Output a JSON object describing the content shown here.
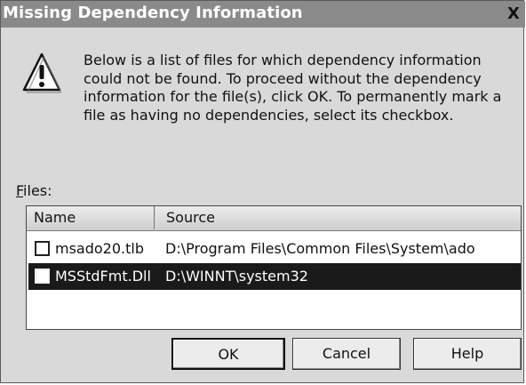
{
  "dialog": {
    "title": "Missing Dependency Information",
    "close_label": "X",
    "message": "Below is a list of files for which dependency information could not be found. To proceed without the dependency information for the file(s), click OK. To permanently mark a file as having no dependencies, select its checkbox.",
    "files_label_accel": "F",
    "files_label_rest": "iles:",
    "columns": {
      "name": "Name",
      "source": "Source"
    },
    "rows": [
      {
        "name": "msado20.tlb",
        "source": "D:\\Program Files\\Common Files\\System\\ado",
        "checked": false,
        "selected": false
      },
      {
        "name": "MSStdFmt.Dll",
        "source": "D:\\WINNT\\system32",
        "checked": false,
        "selected": true
      }
    ],
    "buttons": {
      "ok": "OK",
      "cancel": "Cancel",
      "help": "Help"
    }
  }
}
